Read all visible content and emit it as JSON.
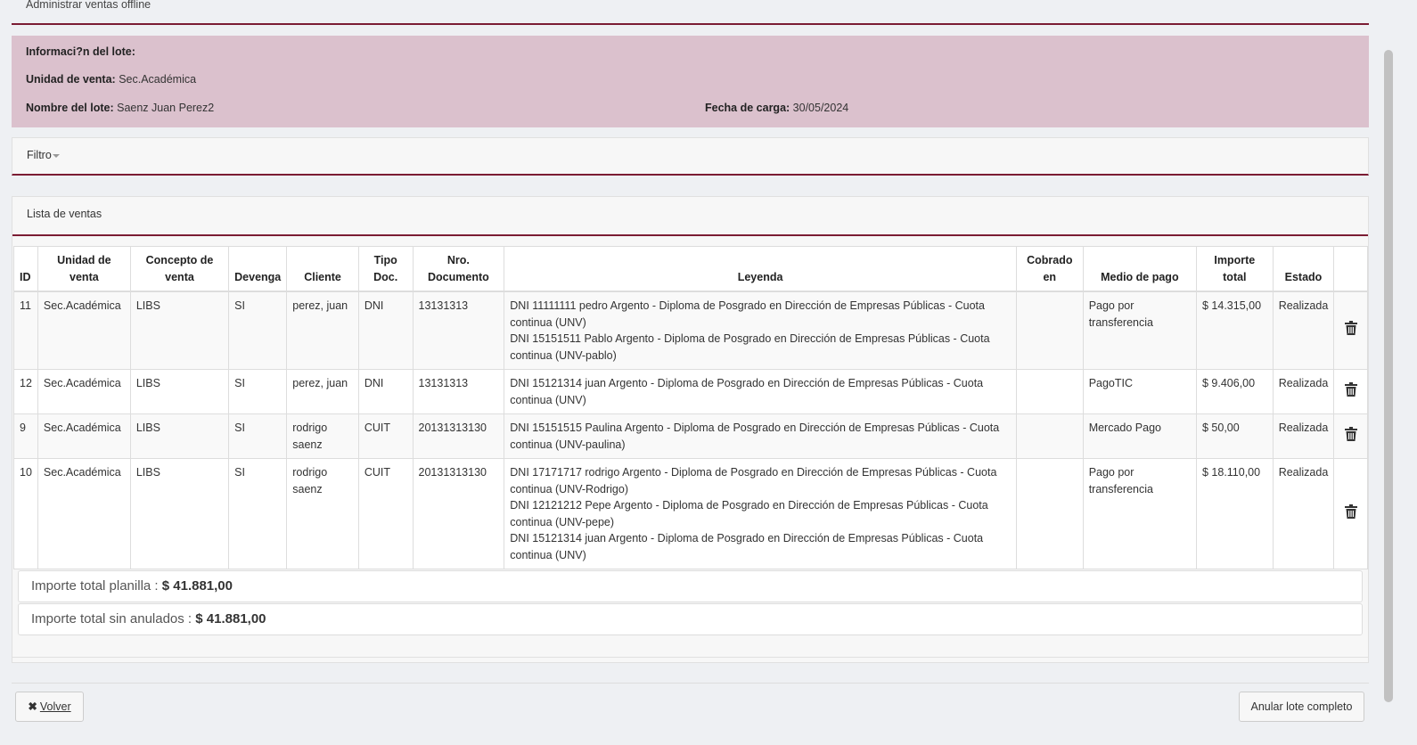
{
  "page": {
    "title": "Administrar ventas offline"
  },
  "lote": {
    "heading": "Informaci?n del lote:",
    "unidad_label": "Unidad de venta:",
    "unidad_value": "Sec.Académica",
    "nombre_label": "Nombre del lote:",
    "nombre_value": "Saenz Juan Perez2",
    "fecha_label": "Fecha de carga:",
    "fecha_value": "30/05/2024"
  },
  "filtro": {
    "label": "Filtro"
  },
  "ventas": {
    "title": "Lista de ventas",
    "columns": {
      "id": "ID",
      "unidad_l1": "Unidad de",
      "unidad_l2": "venta",
      "concepto_l1": "Concepto de",
      "concepto_l2": "venta",
      "devenga": "Devenga",
      "cliente": "Cliente",
      "tipo_l1": "Tipo",
      "tipo_l2": "Doc.",
      "nro_l1": "Nro.",
      "nro_l2": "Documento",
      "leyenda": "Leyenda",
      "cobrado_l1": "Cobrado",
      "cobrado_l2": "en",
      "medio": "Medio de pago",
      "importe_l1": "Importe",
      "importe_l2": "total",
      "estado": "Estado"
    },
    "rows": [
      {
        "id": "11",
        "unidad": "Sec.Académica",
        "concepto": "LIBS",
        "devenga": "SI",
        "cliente": "perez, juan",
        "tipo": "DNI",
        "nro": "13131313",
        "leyenda": [
          "DNI 11111111 pedro Argento - Diploma de Posgrado en Dirección de Empresas Públicas - Cuota continua (UNV)",
          "DNI 15151511 Pablo Argento - Diploma de Posgrado en Dirección de Empresas Públicas - Cuota continua (UNV-pablo)"
        ],
        "cobrado": "",
        "medio": "Pago por transferencia",
        "importe": "$ 14.315,00",
        "estado": "Realizada"
      },
      {
        "id": "12",
        "unidad": "Sec.Académica",
        "concepto": "LIBS",
        "devenga": "SI",
        "cliente": "perez, juan",
        "tipo": "DNI",
        "nro": "13131313",
        "leyenda": [
          "DNI 15121314 juan Argento - Diploma de Posgrado en Dirección de Empresas Públicas - Cuota continua (UNV)"
        ],
        "cobrado": "",
        "medio": "PagoTIC",
        "importe": "$ 9.406,00",
        "estado": "Realizada"
      },
      {
        "id": "9",
        "unidad": "Sec.Académica",
        "concepto": "LIBS",
        "devenga": "SI",
        "cliente": "rodrigo saenz",
        "tipo": "CUIT",
        "nro": "20131313130",
        "leyenda": [
          "DNI 15151515 Paulina Argento - Diploma de Posgrado en Dirección de Empresas Públicas - Cuota continua (UNV-paulina)"
        ],
        "cobrado": "",
        "medio": "Mercado Pago",
        "importe": "$ 50,00",
        "estado": "Realizada"
      },
      {
        "id": "10",
        "unidad": "Sec.Académica",
        "concepto": "LIBS",
        "devenga": "SI",
        "cliente": "rodrigo saenz",
        "tipo": "CUIT",
        "nro": "20131313130",
        "leyenda": [
          "DNI 17171717 rodrigo Argento - Diploma de Posgrado en Dirección de Empresas Públicas - Cuota continua (UNV-Rodrigo)",
          "DNI 12121212 Pepe Argento - Diploma de Posgrado en Dirección de Empresas Públicas - Cuota continua (UNV-pepe)",
          "DNI 15121314 juan Argento - Diploma de Posgrado en Dirección de Empresas Públicas - Cuota continua (UNV)"
        ],
        "cobrado": "",
        "medio": "Pago por transferencia",
        "importe": "$ 18.110,00",
        "estado": "Realizada"
      }
    ],
    "row_action_icon": "trash-icon"
  },
  "totals": {
    "planilla_label": "Importe total planilla :",
    "planilla_value": "$ 41.881,00",
    "sin_anulados_label": "Importe total sin anulados :",
    "sin_anulados_value": "$ 41.881,00"
  },
  "actions": {
    "volver_icon": "close-icon",
    "volver_label": "Volver",
    "anular_label": "Anular lote completo"
  },
  "colors": {
    "accent": "#7b1c33",
    "lote_background": "#dbc1cd",
    "page_background": "#eef0f3"
  }
}
